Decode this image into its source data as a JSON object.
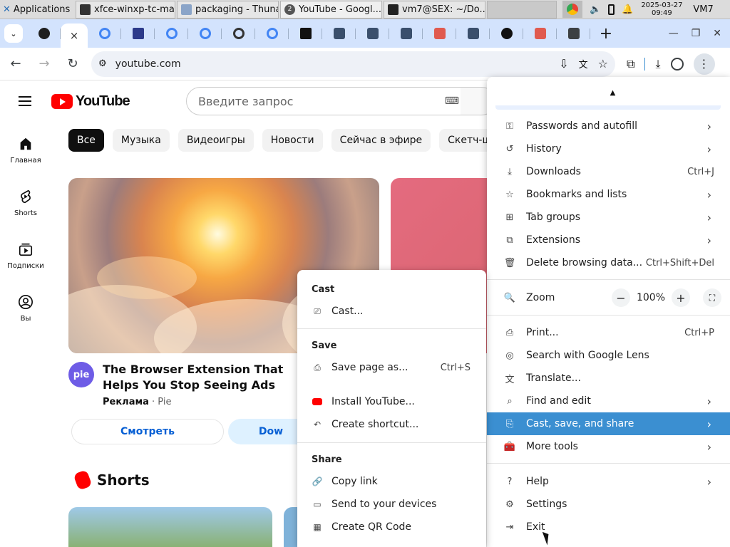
{
  "taskbar": {
    "apps_label": "Applications",
    "tasks": [
      {
        "label": "xfce-winxp-tc-ma...",
        "icon": "terminal-icon"
      },
      {
        "label": "packaging - Thunar",
        "icon": "folder-icon"
      },
      {
        "label": "YouTube - Googl...",
        "icon": "chrome-icon",
        "badge": "2"
      },
      {
        "label": "vm7@SEX: ~/Do...",
        "icon": "terminal-icon"
      }
    ],
    "clock_date": "2025-03-27",
    "clock_time": "09:49",
    "vm_label": "VM7"
  },
  "browser": {
    "url": "youtube.com",
    "tab_close": "×",
    "new_tab": "+",
    "colors": {
      "tabstrip": "#d3e3fd",
      "highlight": "#3b8fd1"
    }
  },
  "youtube": {
    "logo_text": "YouTube",
    "search_placeholder": "Введите запрос",
    "sidebar": [
      {
        "label": "Главная",
        "icon": "home-icon"
      },
      {
        "label": "Shorts",
        "icon": "shorts-icon"
      },
      {
        "label": "Подписки",
        "icon": "subscriptions-icon"
      },
      {
        "label": "Вы",
        "icon": "account-icon"
      }
    ],
    "chips": [
      "Все",
      "Музыка",
      "Видеоигры",
      "Новости",
      "Сейчас в эфире",
      "Скетч-шоу"
    ],
    "ad": {
      "avatar_text": "pie",
      "title": "The Browser Extension That Helps You Stop Seeing Ads",
      "sponsor_label": "Реклама",
      "channel": "Pie",
      "watch_button": "Смотреть",
      "download_button": "Dow"
    },
    "shorts_heading": "Shorts"
  },
  "menu": {
    "items": [
      {
        "label": "Passwords and autofill",
        "icon": "key-icon",
        "chevron": true
      },
      {
        "label": "History",
        "icon": "history-icon",
        "chevron": true
      },
      {
        "label": "Downloads",
        "icon": "download-icon",
        "shortcut": "Ctrl+J"
      },
      {
        "label": "Bookmarks and lists",
        "icon": "star-icon",
        "chevron": true
      },
      {
        "label": "Tab groups",
        "icon": "tab-groups-icon",
        "chevron": true
      },
      {
        "label": "Extensions",
        "icon": "puzzle-icon",
        "chevron": true
      },
      {
        "label": "Delete browsing data...",
        "icon": "trash-icon",
        "shortcut": "Ctrl+Shift+Del"
      }
    ],
    "zoom_label": "Zoom",
    "zoom_value": "100%",
    "zoom_minus": "−",
    "zoom_plus": "+",
    "items2": [
      {
        "label": "Print...",
        "icon": "print-icon",
        "shortcut": "Ctrl+P"
      },
      {
        "label": "Search with Google Lens",
        "icon": "lens-icon"
      },
      {
        "label": "Translate...",
        "icon": "translate-icon"
      },
      {
        "label": "Find and edit",
        "icon": "find-icon",
        "chevron": true
      },
      {
        "label": "Cast, save, and share",
        "icon": "cast-save-icon",
        "chevron": true,
        "highlighted": true
      },
      {
        "label": "More tools",
        "icon": "toolbox-icon",
        "chevron": true
      }
    ],
    "items3": [
      {
        "label": "Help",
        "icon": "help-icon",
        "chevron": true
      },
      {
        "label": "Settings",
        "icon": "gear-icon"
      },
      {
        "label": "Exit",
        "icon": "exit-icon"
      }
    ]
  },
  "submenu": {
    "cast_heading": "Cast",
    "cast_item": "Cast...",
    "save_heading": "Save",
    "save_page": "Save page as...",
    "save_page_shortcut": "Ctrl+S",
    "install": "Install YouTube...",
    "create_shortcut": "Create shortcut...",
    "share_heading": "Share",
    "copy_link": "Copy link",
    "send_devices": "Send to your devices",
    "qr_code": "Create QR Code"
  }
}
